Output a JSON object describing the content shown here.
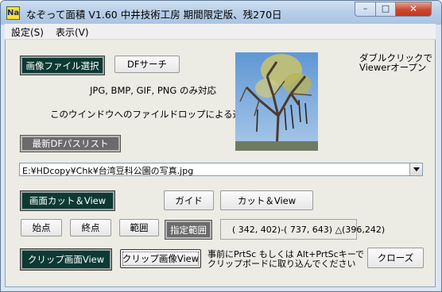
{
  "window": {
    "title": "なぞって面積 V1.60 中井技術工房 期間限定版、残270日",
    "icon_name": "app-icon",
    "icon_text": "Na"
  },
  "menubar": {
    "items": [
      "設定(S)",
      "表示(V)"
    ]
  },
  "buttons": {
    "open_image": "画像ファイル選択",
    "df_search": "DFサーチ",
    "recent_df_list": "最新DFパスリスト",
    "cut_view": "画面カット＆View",
    "guide": "ガイド",
    "cut_and_view": "カット＆View",
    "start_point": "始点",
    "end_point": "終点",
    "range": "範囲",
    "specified_range": "指定範囲",
    "clip_screen_view": "クリップ画面View",
    "clip_image_view": "クリップ画像View",
    "close": "クローズ"
  },
  "labels": {
    "formats": "JPG, BMP, GIF, PNG のみ対応",
    "drop_hint": "このウインドウへのファイルドロップによる選択可",
    "double_click_line1": "ダブルクリックで",
    "double_click_line2": "Viewerオープン",
    "prtsc_line1": "事前にPrtSc もしくは Alt+PrtScキーで",
    "prtsc_line2": "クリップボードに取り込んでください"
  },
  "file_path": {
    "value": "E:¥HDcopy¥Chk¥台湾豆科公園の写真.jpg"
  },
  "coordinates": {
    "readout": "( 342, 402)-( 737, 643)  △(396,242)"
  },
  "colors": {
    "dark_button": "#0c3a33",
    "gray_button": "#6b6b6b",
    "close_button": "#c9492f"
  }
}
